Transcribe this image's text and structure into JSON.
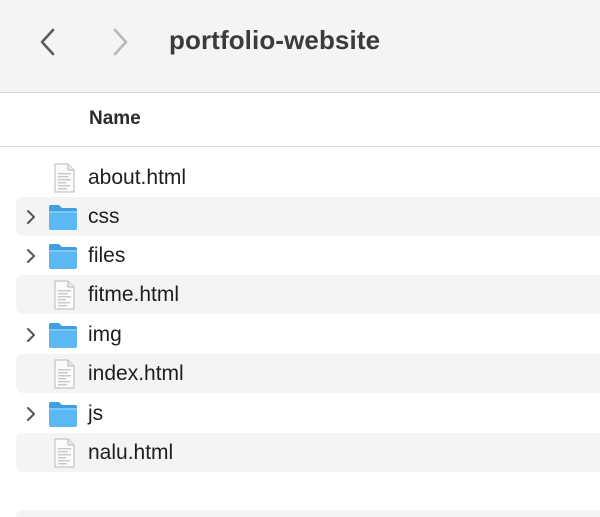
{
  "toolbar": {
    "title": "portfolio-website",
    "back_icon": "chevron-left-icon",
    "forward_icon": "chevron-right-icon"
  },
  "columns": {
    "name": "Name"
  },
  "items": [
    {
      "label": "about.html",
      "kind": "file"
    },
    {
      "label": "css",
      "kind": "folder"
    },
    {
      "label": "files",
      "kind": "folder"
    },
    {
      "label": "fitme.html",
      "kind": "file"
    },
    {
      "label": "img",
      "kind": "folder"
    },
    {
      "label": "index.html",
      "kind": "file"
    },
    {
      "label": "js",
      "kind": "folder"
    },
    {
      "label": "nalu.html",
      "kind": "file"
    }
  ],
  "colors": {
    "folder": "#56b3ee",
    "toolbar_bg": "#f5f4f3",
    "row_alt": "#f4f4f4"
  }
}
